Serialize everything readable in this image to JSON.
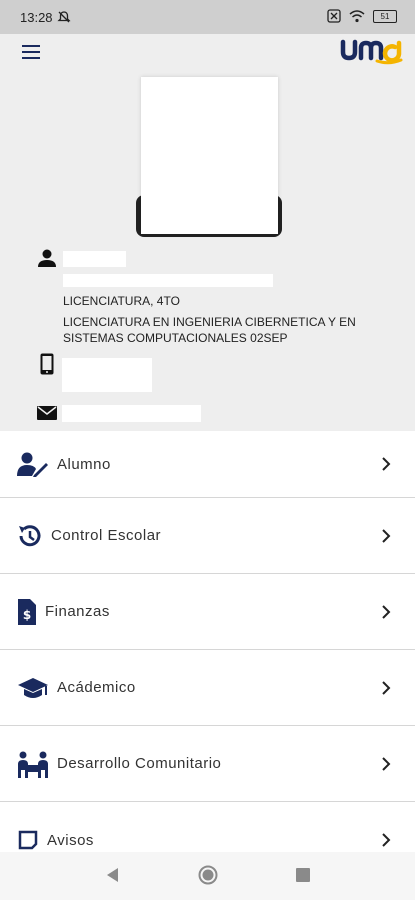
{
  "status_bar": {
    "time": "13:28",
    "battery": "51",
    "icons": [
      "mute-icon",
      "close-box-icon",
      "wifi-icon",
      "battery-icon"
    ]
  },
  "header": {
    "menu_icon": "hamburger-icon",
    "logo_text": "umg"
  },
  "profile": {
    "program": "LICENCIATURA, 4TO",
    "career_line1": "LICENCIATURA EN INGENIERIA CIBERNETICA Y EN",
    "career_line2": "SISTEMAS COMPUTACIONALES 02SEP"
  },
  "menu": [
    {
      "label": "Alumno",
      "icon": "student-icon"
    },
    {
      "label": "Control Escolar",
      "icon": "history-icon"
    },
    {
      "label": "Finanzas",
      "icon": "invoice-icon"
    },
    {
      "label": "Acádemico",
      "icon": "graduation-cap-icon"
    },
    {
      "label": "Desarrollo Comunitario",
      "icon": "people-icon"
    },
    {
      "label": "Avisos",
      "icon": "notice-icon"
    }
  ],
  "colors": {
    "accent": "#1a2a5e",
    "logo_yellow": "#f4b400",
    "header_bg": "#eeeeee"
  }
}
